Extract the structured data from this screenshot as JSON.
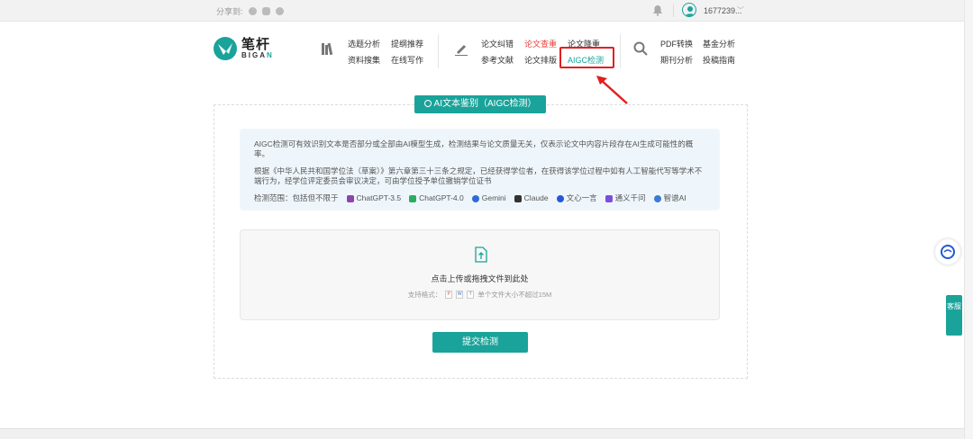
{
  "topbar": {
    "share_label": "分享到:",
    "username": "1677239..."
  },
  "brand": {
    "name_cn": "笔杆",
    "name_en_main": "BIGA",
    "name_en_accent": "N"
  },
  "nav": {
    "group1": [
      "选题分析",
      "资料搜集",
      "提纲推荐",
      "在线写作"
    ],
    "group2": [
      "论文纠错",
      "参考文献",
      "论文查重",
      "论文排版",
      "论文降重",
      "AIGC检测"
    ],
    "group3": [
      "PDF转换",
      "期刊分析",
      "基金分析",
      "投稿指南"
    ]
  },
  "badge": "AI文本鉴别（AIGC检测）",
  "info": {
    "p1": "AIGC检测可有效识别文本是否部分或全部由AI模型生成，检测结果与论文质量无关，仅表示论文中内容片段存在AI生成可能性的概率。",
    "p2": "根据《中华人民共和国学位法（草案）》第六章第三十三条之规定，已经获得学位者，在获得该学位过程中如有人工智能代写等学术不端行为，经学位评定委员会审议决定，可由学位授予单位撤销学位证书",
    "scope_label": "检测范围：包括但不限于",
    "models": [
      {
        "name": "ChatGPT-3.5",
        "color": "#8e44ad"
      },
      {
        "name": "ChatGPT-4.0",
        "color": "#27ae60"
      },
      {
        "name": "Gemini",
        "color": "#2f6ad9"
      },
      {
        "name": "Claude",
        "color": "#333333"
      },
      {
        "name": "文心一言",
        "color": "#2458d6"
      },
      {
        "name": "通义千问",
        "color": "#7b4de0"
      },
      {
        "name": "智谱AI",
        "color": "#3a7bd5"
      }
    ]
  },
  "upload": {
    "title": "点击上传或拖拽文件到此处",
    "formats_label": "支持格式：",
    "formats": [
      "P",
      "W",
      "T"
    ],
    "size_note": "单个文件大小不超过15M"
  },
  "submit_label": "提交检测",
  "float_service": "客服",
  "colors": {
    "primary": "#1aa39a",
    "highlight_red": "#e02020",
    "info_bg": "#eff6fb"
  }
}
